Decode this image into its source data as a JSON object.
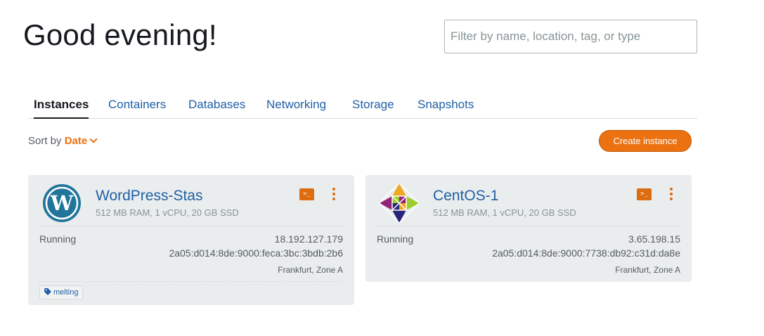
{
  "greeting": "Good evening!",
  "filter": {
    "placeholder": "Filter by name, location, tag, or type"
  },
  "tabs": [
    {
      "label": "Instances",
      "active": true
    },
    {
      "label": "Containers"
    },
    {
      "label": "Databases"
    },
    {
      "label": "Networking"
    },
    {
      "label": "Storage"
    },
    {
      "label": "Snapshots"
    }
  ],
  "sort": {
    "prefix": "Sort by",
    "value": "Date"
  },
  "create_button": "Create instance",
  "colors": {
    "accent": "#ec7211",
    "link": "#1f5fa6",
    "card_bg": "#eaeded"
  },
  "instances": [
    {
      "name": "WordPress-Stas",
      "icon": "wordpress-icon",
      "specs": "512 MB RAM, 1 vCPU, 20 GB SSD",
      "status": "Running",
      "ipv4": "18.192.127.179",
      "ipv6": "2a05:d014:8de:9000:feca:3bc:3bdb:2b6",
      "location": "Frankfurt, Zone A",
      "tags": [
        "melting"
      ]
    },
    {
      "name": "CentOS-1",
      "icon": "centos-icon",
      "specs": "512 MB RAM, 1 vCPU, 20 GB SSD",
      "status": "Running",
      "ipv4": "3.65.198.15",
      "ipv6": "2a05:d014:8de:9000:7738:db92:c31d:da8e",
      "location": "Frankfurt, Zone A",
      "tags": []
    }
  ],
  "terminal_icon_glyph": ">_"
}
